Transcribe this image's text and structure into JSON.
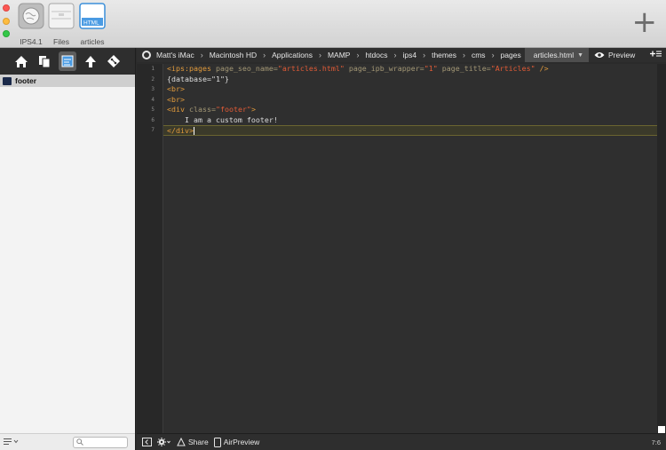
{
  "toolbar": {
    "items": [
      {
        "label": "IPS4.1",
        "icon": "globe-icon"
      },
      {
        "label": "Files",
        "icon": "folder-icon"
      },
      {
        "label": "articles",
        "icon": "html-file-icon",
        "badge": "HTML"
      }
    ],
    "add_label": "+"
  },
  "sidebar": {
    "tools": [
      "home-icon",
      "documents-icon",
      "editor-icon",
      "upload-icon",
      "git-icon"
    ],
    "files": [
      {
        "name": "footer"
      }
    ],
    "search_placeholder": ""
  },
  "breadcrumb": {
    "items": [
      "Matt's iMac",
      "Macintosh HD",
      "Applications",
      "MAMP",
      "htdocs",
      "ips4",
      "themes",
      "cms",
      "pages"
    ],
    "current": "articles.html",
    "preview_label": "Preview"
  },
  "editor": {
    "line_numbers": [
      "1",
      "2",
      "3",
      "4",
      "5",
      "6",
      "7"
    ],
    "current_line": 7,
    "lines": [
      [
        {
          "t": "tag",
          "v": "<ips:pages "
        },
        {
          "t": "attr",
          "v": "page_seo_name="
        },
        {
          "t": "str",
          "v": "\"articles.html\""
        },
        {
          "t": "attr",
          "v": " page_ipb_wrapper="
        },
        {
          "t": "str",
          "v": "\"1\""
        },
        {
          "t": "attr",
          "v": " page_title="
        },
        {
          "t": "str",
          "v": "\"Articles\""
        },
        {
          "t": "tag",
          "v": " />"
        }
      ],
      [
        {
          "t": "txt",
          "v": "{database=\"1\"}"
        }
      ],
      [
        {
          "t": "tag",
          "v": "<br>"
        }
      ],
      [
        {
          "t": "tag",
          "v": "<br>"
        }
      ],
      [
        {
          "t": "tag",
          "v": "<div "
        },
        {
          "t": "attr",
          "v": "class="
        },
        {
          "t": "str",
          "v": "\"footer\""
        },
        {
          "t": "tag",
          "v": ">"
        }
      ],
      [
        {
          "t": "txt",
          "v": "    I am a custom footer!"
        }
      ],
      [
        {
          "t": "tag",
          "v": "</div>"
        }
      ]
    ]
  },
  "statusbar": {
    "share_label": "Share",
    "airpreview_label": "AirPreview",
    "cursor_position": "7:6"
  },
  "colors": {
    "tag": "#e29b3c",
    "attribute": "#a39775",
    "string": "#e25b36",
    "background": "#2f2f2f"
  }
}
